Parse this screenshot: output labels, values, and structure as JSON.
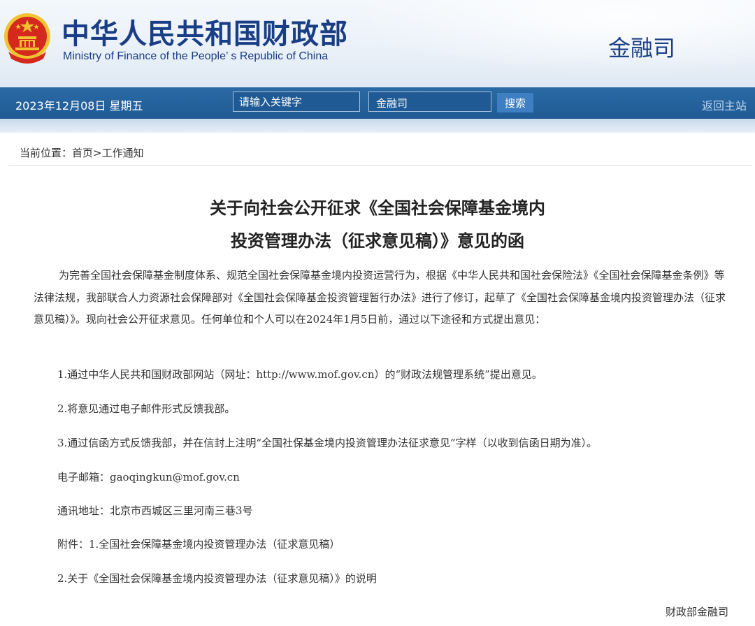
{
  "header": {
    "title_cn": "中华人民共和国财政部",
    "title_en": "Ministry of Finance of the People’ s Republic of China",
    "dept": "金融司"
  },
  "nav": {
    "date": "2023年12月08日  星期五",
    "search_placeholder": "请输入关键字",
    "scope_value": "金融司",
    "search_button": "搜索",
    "home_link": "返回主站"
  },
  "breadcrumb": {
    "label": "当前位置：",
    "home": "首页",
    "sep": ">",
    "current": "工作通知"
  },
  "article": {
    "title_line1": "关于向社会公开征求《全国社会保障基金境内",
    "title_line2": "投资管理办法（征求意见稿）》意见的函",
    "intro": "为完善全国社会保障基金制度体系、规范全国社会保障基金境内投资运营行为，根据《中华人民共和国社会保险法》《全国社会保障基金条例》等法律法规，我部联合人力资源社会保障部对《全国社会保障基金投资管理暂行办法》进行了修订，起草了《全国社会保障基金境内投资管理办法（征求意见稿）》。现向社会公开征求意见。任何单位和个人可以在2024年1月5日前，通过以下途径和方式提出意见：",
    "item1": "1.通过中华人民共和国财政部网站（网址：http://www.mof.gov.cn）的“财政法规管理系统”提出意见。",
    "item2": "2.将意见通过电子邮件形式反馈我部。",
    "item3": "3.通过信函方式反馈我部，并在信封上注明“全国社保基金境内投资管理办法征求意见”字样（以收到信函日期为准）。",
    "email": "电子邮箱：gaoqingkun@mof.gov.cn",
    "address": "通讯地址：北京市西城区三里河南三巷3号",
    "attachment1": "附件：1.全国社会保障基金境内投资管理办法（征求意见稿）",
    "attachment2": "2.关于《全国社会保障基金境内投资管理办法（征求意见稿）》的说明",
    "signature": "财政部金融司"
  },
  "colors": {
    "nav_bg": "#1f5a94",
    "title_blue": "#1a3e85",
    "emblem_red": "#d42a1e",
    "emblem_gold": "#f2c230"
  }
}
